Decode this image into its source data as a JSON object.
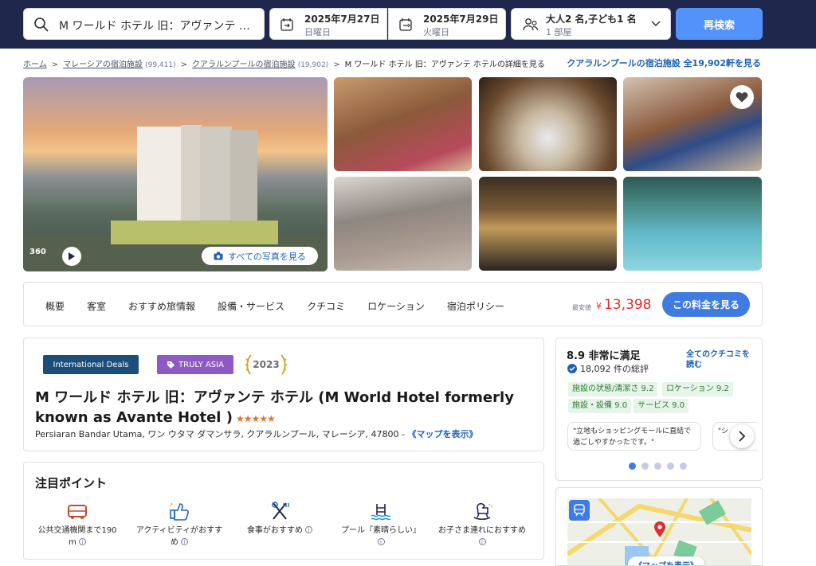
{
  "search": {
    "query": "M ワールド ホテル 旧：アヴァンテ ホ...",
    "checkin_date": "2025年7月27日",
    "checkin_day": "日曜日",
    "checkout_date": "2025年7月29日",
    "checkout_day": "火曜日",
    "guests": "大人2 名,子ども1 名",
    "rooms": "1 部屋",
    "search_button": "再検索"
  },
  "breadcrumb": {
    "home": "ホーム",
    "malaysia": "マレーシアの宿泊施設",
    "malaysia_count": "(99,411)",
    "kl": "クアラルンプールの宿泊施設",
    "kl_count": "(19,902)",
    "current": "M ワールド ホテル 旧：アヴァンテ ホテルの詳細を見る",
    "right_link": "クアラルンプールの宿泊施設 全19,902軒を見る"
  },
  "gallery": {
    "badge_360": "360",
    "all_photos": "すべての写真を見る"
  },
  "nav": {
    "tabs": [
      "概要",
      "客室",
      "おすすめ旅情報",
      "設備・サービス",
      "クチコミ",
      "ロケーション",
      "宿泊ポリシー"
    ],
    "lowest_label": "最安値",
    "currency": "¥",
    "price": "13,398",
    "price_button": "この料金を見る"
  },
  "hotel": {
    "badge_deals": "International Deals",
    "badge_asia": "TRULY ASIA",
    "badge_year": "2023",
    "name": "M ワールド ホテル 旧：アヴァンテ ホテル (M World Hotel formerly known as Avante Hotel )",
    "stars": "★★★★★",
    "address": "Persiaran Bandar Utama, ワン ウタマ ダマンサラ, クアラルンプール, マレーシア, 47800 - ",
    "map_link": "《マップを表示》"
  },
  "highlights": {
    "title": "注目ポイント",
    "items": [
      {
        "label": "公共交通機関まで190 m",
        "icon": "bus-icon"
      },
      {
        "label": "アクティビティがおすすめ",
        "icon": "thumbs-up-icon"
      },
      {
        "label": "食事がおすすめ",
        "icon": "utensils-icon"
      },
      {
        "label": "プール『素晴らしい』",
        "icon": "pool-icon"
      },
      {
        "label": "お子さま連れにおすすめ",
        "icon": "rocking-horse-icon"
      }
    ],
    "info_glyph": "i"
  },
  "reviews": {
    "score": "8.9 非常に満足",
    "all_link": "全てのクチコミを読む",
    "count": "18,092 件の総評",
    "tags": [
      "施設の状態/清潔さ 9.2",
      "ロケーション 9.2",
      "施設・設備 9.0",
      "サービス 9.0"
    ],
    "quote1": "\"立地もショッピングモールに直結で過ごしやすかったです。\"",
    "quote2": "\"シ ぐの"
  },
  "map": {
    "show_map": "《マップを表示》"
  },
  "colors": {
    "topbar": "#20274d",
    "accent": "#5392f9",
    "price_red": "#e12d2d",
    "link_blue": "#1e62b6"
  }
}
